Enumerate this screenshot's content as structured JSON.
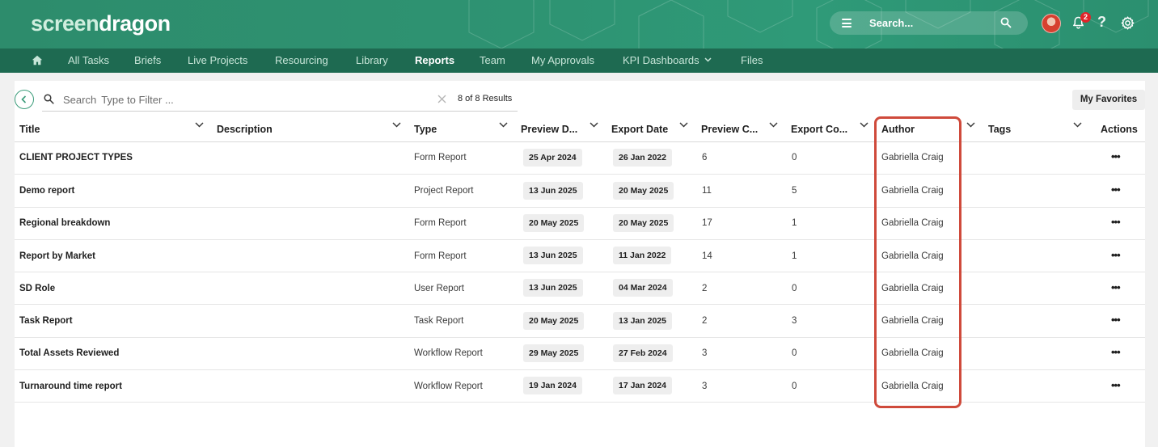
{
  "header": {
    "logo_part1": "screen",
    "logo_part2": "dragon",
    "search_placeholder": "Search...",
    "notification_count": "2",
    "help_glyph": "?"
  },
  "nav": {
    "items": [
      "All Tasks",
      "Briefs",
      "Live Projects",
      "Resourcing",
      "Library",
      "Reports",
      "Team",
      "My Approvals",
      "KPI Dashboards",
      "Files"
    ],
    "active": "Reports"
  },
  "toolbar": {
    "filter_label": "Search",
    "filter_placeholder": "Type to Filter ...",
    "result_count": "8 of 8 Results",
    "favorites_label": "My Favorites"
  },
  "table": {
    "headers": {
      "title": "Title",
      "description": "Description",
      "type": "Type",
      "preview_date": "Preview D...",
      "export_date": "Export Date",
      "preview_count": "Preview C...",
      "export_count": "Export Co...",
      "author": "Author",
      "tags": "Tags",
      "actions": "Actions"
    },
    "rows": [
      {
        "title": "CLIENT PROJECT TYPES",
        "description": "",
        "type": "Form Report",
        "preview_date": "25 Apr 2024",
        "export_date": "26 Jan 2022",
        "preview_count": "6",
        "export_count": "0",
        "author": "Gabriella Craig",
        "tags": "",
        "actions": "•••"
      },
      {
        "title": "Demo report",
        "description": "",
        "type": "Project Report",
        "preview_date": "13 Jun 2025",
        "export_date": "20 May 2025",
        "preview_count": "11",
        "export_count": "5",
        "author": "Gabriella Craig",
        "tags": "",
        "actions": "•••"
      },
      {
        "title": "Regional breakdown",
        "description": "",
        "type": "Form Report",
        "preview_date": "20 May 2025",
        "export_date": "20 May 2025",
        "preview_count": "17",
        "export_count": "1",
        "author": "Gabriella Craig",
        "tags": "",
        "actions": "•••"
      },
      {
        "title": "Report by Market",
        "description": "",
        "type": "Form Report",
        "preview_date": "13 Jun 2025",
        "export_date": "11 Jan 2022",
        "preview_count": "14",
        "export_count": "1",
        "author": "Gabriella Craig",
        "tags": "",
        "actions": "•••"
      },
      {
        "title": "SD Role",
        "description": "",
        "type": "User Report",
        "preview_date": "13 Jun 2025",
        "export_date": "04 Mar 2024",
        "preview_count": "2",
        "export_count": "0",
        "author": "Gabriella Craig",
        "tags": "",
        "actions": "•••"
      },
      {
        "title": "Task Report",
        "description": "",
        "type": "Task Report",
        "preview_date": "20 May 2025",
        "export_date": "13 Jan 2025",
        "preview_count": "2",
        "export_count": "3",
        "author": "Gabriella Craig",
        "tags": "",
        "actions": "•••"
      },
      {
        "title": "Total Assets Reviewed",
        "description": "",
        "type": "Workflow Report",
        "preview_date": "29 May 2025",
        "export_date": "27 Feb 2024",
        "preview_count": "3",
        "export_count": "0",
        "author": "Gabriella Craig",
        "tags": "",
        "actions": "•••"
      },
      {
        "title": "Turnaround time report",
        "description": "",
        "type": "Workflow Report",
        "preview_date": "19 Jan 2024",
        "export_date": "17 Jan 2024",
        "preview_count": "3",
        "export_count": "0",
        "author": "Gabriella Craig",
        "tags": "",
        "actions": "•••"
      }
    ]
  },
  "colors": {
    "header_green": "#2e9372",
    "nav_green": "#1e6a51",
    "highlight_red": "#cf4a3b"
  },
  "icons": [
    "home-icon",
    "menu-icon",
    "search-icon",
    "bell-icon",
    "help-icon",
    "gear-icon",
    "back-arrow-icon",
    "clear-icon",
    "chevron-down-icon",
    "more-actions-icon"
  ]
}
